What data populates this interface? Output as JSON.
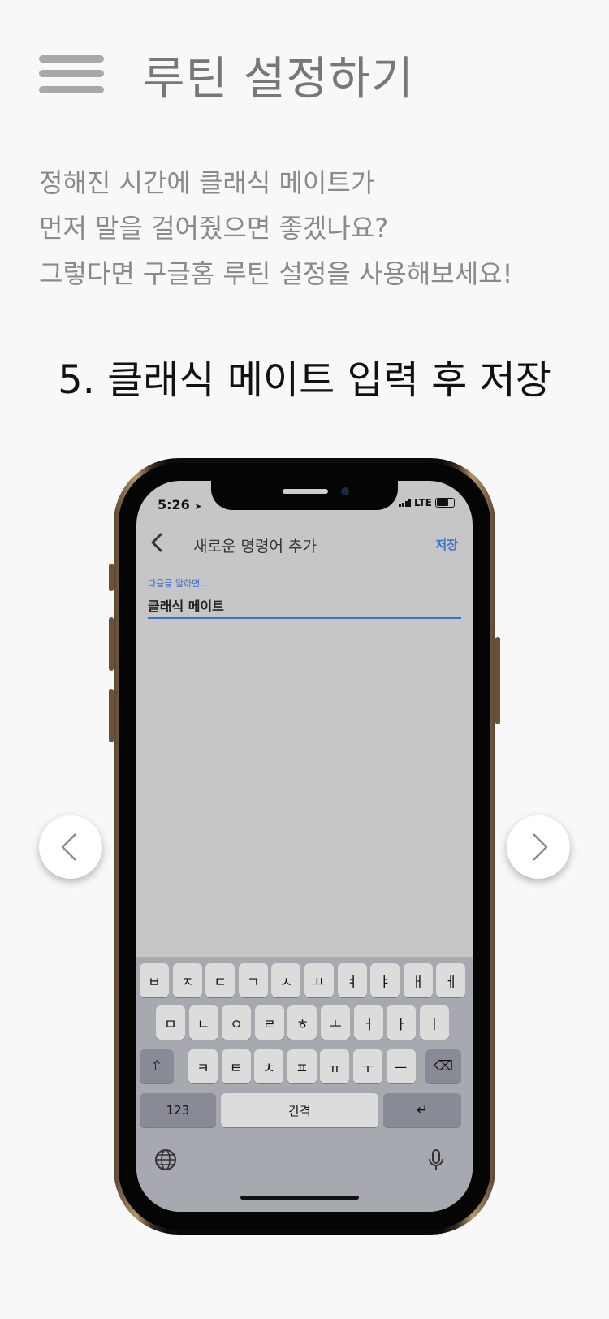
{
  "header": {
    "title": "루틴 설정하기",
    "menu_icon": "hamburger-menu-icon"
  },
  "intro": {
    "line1": "정해진 시간에 클래식 메이트가",
    "line2": "먼저 말을 걸어줬으면 좋겠나요?",
    "line3": "그렇다면 구글홈 루틴 설정을 사용해보세요!"
  },
  "step": {
    "title": "5. 클래식 메이트 입력 후 저장"
  },
  "phone": {
    "status": {
      "time": "5:26",
      "network": "LTE"
    },
    "nav": {
      "back_icon": "chevron-left-icon",
      "title": "새로운 명령어 추가",
      "save": "저장"
    },
    "field": {
      "label": "다음을 말하면...",
      "value": "클래식 메이트"
    },
    "keyboard": {
      "row1": [
        "ㅂ",
        "ㅈ",
        "ㄷ",
        "ㄱ",
        "ㅅ",
        "ㅛ",
        "ㅕ",
        "ㅑ",
        "ㅐ",
        "ㅔ"
      ],
      "row2": [
        "ㅁ",
        "ㄴ",
        "ㅇ",
        "ㄹ",
        "ㅎ",
        "ㅗ",
        "ㅓ",
        "ㅏ",
        "ㅣ"
      ],
      "row3": [
        "ㅋ",
        "ㅌ",
        "ㅊ",
        "ㅍ",
        "ㅠ",
        "ㅜ",
        "ㅡ"
      ],
      "shift": "⇧",
      "delete": "⌫",
      "numbers": "123",
      "space": "간격",
      "return": "↵",
      "globe_icon": "globe-icon",
      "mic_icon": "microphone-icon"
    }
  },
  "carousel": {
    "prev_icon": "chevron-left-icon",
    "next_icon": "chevron-right-icon"
  },
  "colors": {
    "accent": "#3b6fd0",
    "text_gray": "#8a8a8a",
    "background": "#f8f8f8"
  }
}
